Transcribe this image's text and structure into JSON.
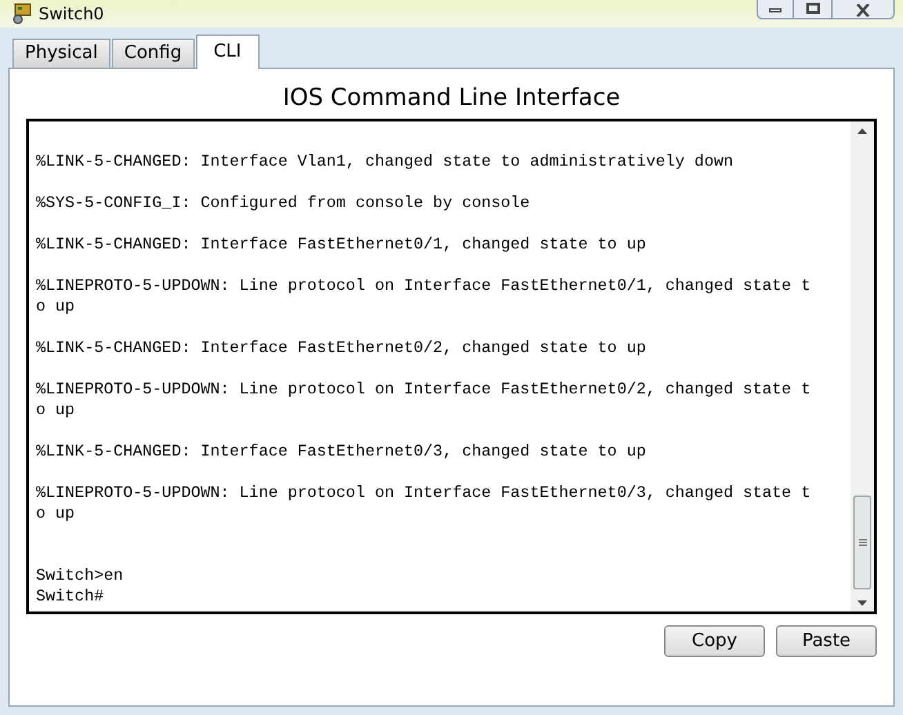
{
  "window": {
    "title": "Switch0"
  },
  "tabs": [
    {
      "label": "Physical",
      "selected": false
    },
    {
      "label": "Config",
      "selected": false
    },
    {
      "label": "CLI",
      "selected": true
    }
  ],
  "heading": "IOS Command Line Interface",
  "console": {
    "messages": [
      [
        "%LINK-5-CHANGED: Interface Vlan1, changed state to administratively down"
      ],
      [
        "%SYS-5-CONFIG_I: Configured from console by console"
      ],
      [
        "%LINK-5-CHANGED: Interface FastEthernet0/1, changed state to up"
      ],
      [
        "%LINEPROTO-5-UPDOWN: Line protocol on Interface FastEthernet0/1, changed state t",
        "o up"
      ],
      [
        "%LINK-5-CHANGED: Interface FastEthernet0/2, changed state to up"
      ],
      [
        "%LINEPROTO-5-UPDOWN: Line protocol on Interface FastEthernet0/2, changed state t",
        "o up"
      ],
      [
        "%LINK-5-CHANGED: Interface FastEthernet0/3, changed state to up"
      ],
      [
        "%LINEPROTO-5-UPDOWN: Line protocol on Interface FastEthernet0/3, changed state t",
        "o up"
      ]
    ],
    "prompt_lines": [
      "Switch>en",
      "Switch#"
    ]
  },
  "buttons": [
    "Copy",
    "Paste"
  ]
}
